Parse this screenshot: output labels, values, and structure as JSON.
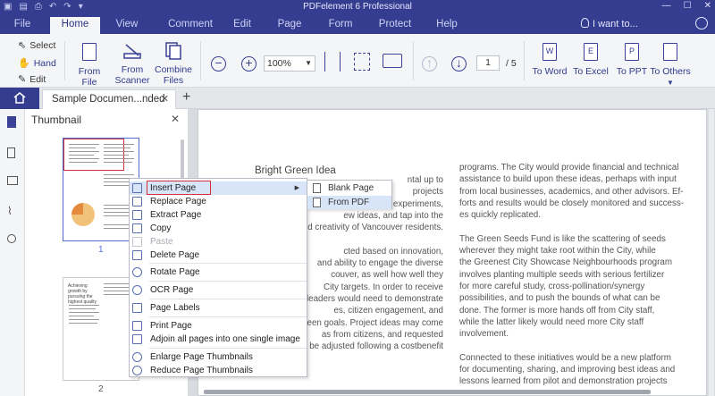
{
  "window": {
    "title": "PDFelement 6 Professional"
  },
  "menu": {
    "tabs": [
      "File",
      "Home",
      "View",
      "Comment",
      "Edit",
      "Page",
      "Form",
      "Protect",
      "Help"
    ],
    "active": "Home",
    "i_want": "I want to..."
  },
  "ribbon": {
    "tools": {
      "select": "Select",
      "hand": "Hand",
      "edit": "Edit"
    },
    "create": {
      "from_file": "From File",
      "from_scanner": "From Scanner",
      "combine": "Combine Files"
    },
    "zoom": "100%",
    "page_current": "1",
    "page_total": "/ 5",
    "convert": {
      "word": "To Word",
      "excel": "To Excel",
      "ppt": "To PPT",
      "others": "To Others"
    }
  },
  "tabs": {
    "document": "Sample Documen...nded"
  },
  "thumbnail": {
    "header": "Thumbnail",
    "pages": [
      "1",
      "2"
    ],
    "page2_heading": "Achieving growth by pursuing the highest quality"
  },
  "document": {
    "title": "Bright Green Idea",
    "left_col": [
      "ntal up to",
      "projects",
      "ts to stimulate bold experiments,",
      "ew ideas, and tap into the",
      "and creativity of Vancouver residents.",
      "",
      "cted based on innovation,",
      "and ability to engage the diverse",
      "couver, as well how well they",
      "City targets. In order to receive",
      "leaders would need to demonstrate",
      "es, citizen engagement, and",
      "een goals. Project ideas may come",
      "as from citizens, and requested",
      "n be adjusted following a costbenefit"
    ],
    "right_col": [
      "programs. The City would provide financial and technical",
      "assistance to build upon these ideas, perhaps with input",
      "from local businesses, academics, and other advisors. Ef-",
      "forts and results would be closely monitored and success-",
      "es quickly replicated.",
      "",
      "The Green Seeds Fund is like the scattering of seeds",
      "wherever they might take root within the City, while",
      "the Greenest City Showcase Neighbourhoods program",
      "involves planting multiple seeds with serious fertilizer",
      "for more careful study, cross-pollination/synergy",
      "possibilities, and to push the bounds of what can be",
      "done. The former is more hands off from City staff,",
      "while the latter likely would need more City staff",
      "involvement.",
      "",
      "Connected to these initiatives would be a new platform",
      "for documenting, sharing, and improving best ideas and",
      "lessons learned from pilot and demonstration projects"
    ]
  },
  "context_menu": {
    "items": [
      {
        "label": "Insert Page",
        "icon": "insert-page-icon",
        "highlighted": true,
        "submenu": true
      },
      {
        "label": "Replace Page",
        "icon": "replace-page-icon"
      },
      {
        "label": "Extract Page",
        "icon": "extract-page-icon"
      },
      {
        "label": "Copy",
        "icon": "copy-icon"
      },
      {
        "label": "Paste",
        "icon": "paste-icon",
        "disabled": true
      },
      {
        "label": "Delete Page",
        "icon": "delete-page-icon"
      },
      {
        "label": "Rotate Page",
        "icon": "rotate-page-icon"
      },
      {
        "label": "OCR Page",
        "icon": "ocr-icon"
      },
      {
        "label": "Page Labels",
        "icon": "page-labels-icon"
      },
      {
        "label": "Print Page",
        "icon": "print-icon"
      },
      {
        "label": "Adjoin all pages into one single image",
        "icon": "adjoin-icon"
      },
      {
        "label": "Enlarge Page Thumbnails",
        "icon": "zoom-in-icon"
      },
      {
        "label": "Reduce Page Thumbnails",
        "icon": "zoom-out-icon"
      }
    ],
    "submenu": [
      {
        "label": "Blank Page"
      },
      {
        "label": "From PDF",
        "highlighted": true
      }
    ]
  },
  "colors": {
    "brand": "#343d8f",
    "highlight": "#d8e4f7",
    "frame": "#d3303b"
  }
}
